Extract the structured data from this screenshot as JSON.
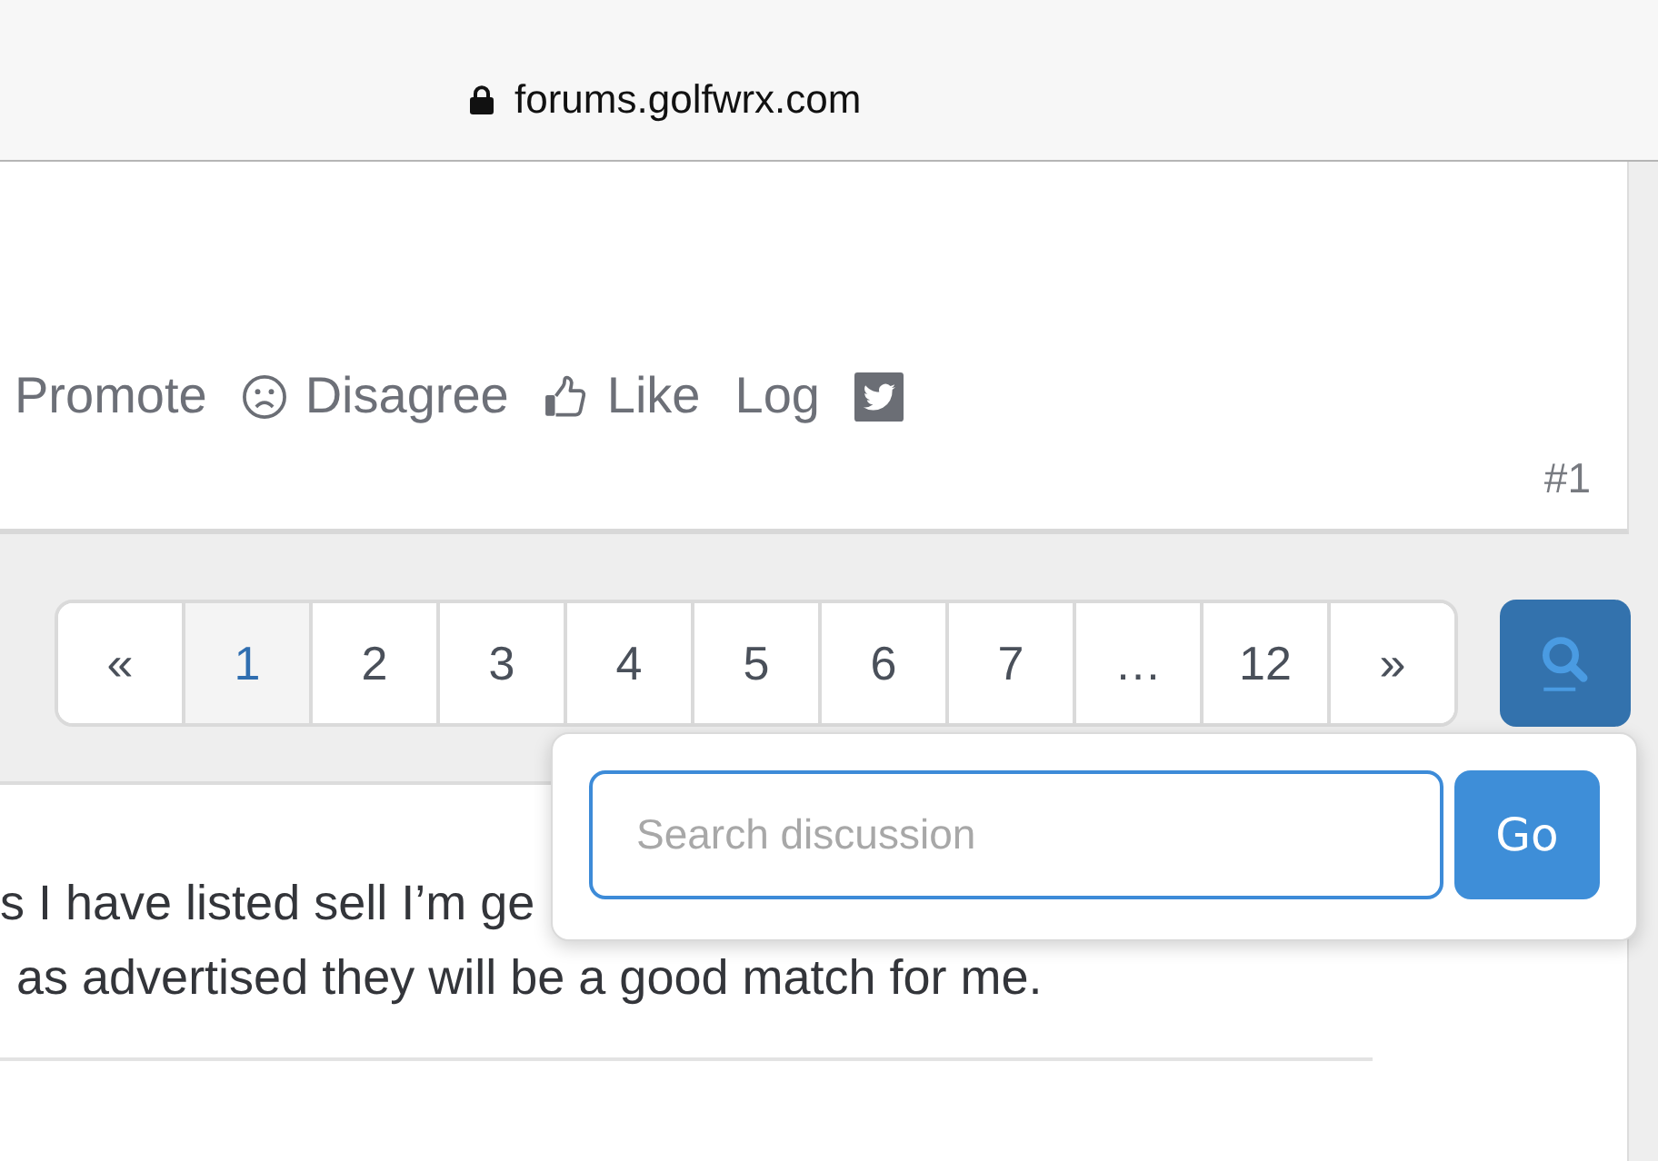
{
  "browser_bar": {
    "secure": true,
    "url": "forums.golfwrx.com"
  },
  "post": {
    "actions": [
      {
        "kind": "plain",
        "label": "Promote"
      },
      {
        "kind": "disagree",
        "label": "Disagree"
      },
      {
        "kind": "like",
        "label": "Like"
      },
      {
        "kind": "plain",
        "label": "Log"
      },
      {
        "kind": "share"
      }
    ],
    "number": "#1"
  },
  "pagination": {
    "pages": [
      {
        "label": "«",
        "selected": false
      },
      {
        "label": "1",
        "selected": true
      },
      {
        "label": "2",
        "selected": false
      },
      {
        "label": "3",
        "selected": false
      },
      {
        "label": "4",
        "selected": false
      },
      {
        "label": "5",
        "selected": false
      },
      {
        "label": "6",
        "selected": false
      },
      {
        "label": "7",
        "selected": false
      },
      {
        "label": "…",
        "selected": false
      },
      {
        "label": "12",
        "selected": false
      },
      {
        "label": "»",
        "selected": false
      }
    ]
  },
  "search": {
    "expanded": true,
    "placeholder": "Search discussion",
    "submit": "Go"
  },
  "next_post": {
    "lines": [
      "s I have listed sell I’m ge",
      "as advertised they will be a good match for me."
    ]
  }
}
